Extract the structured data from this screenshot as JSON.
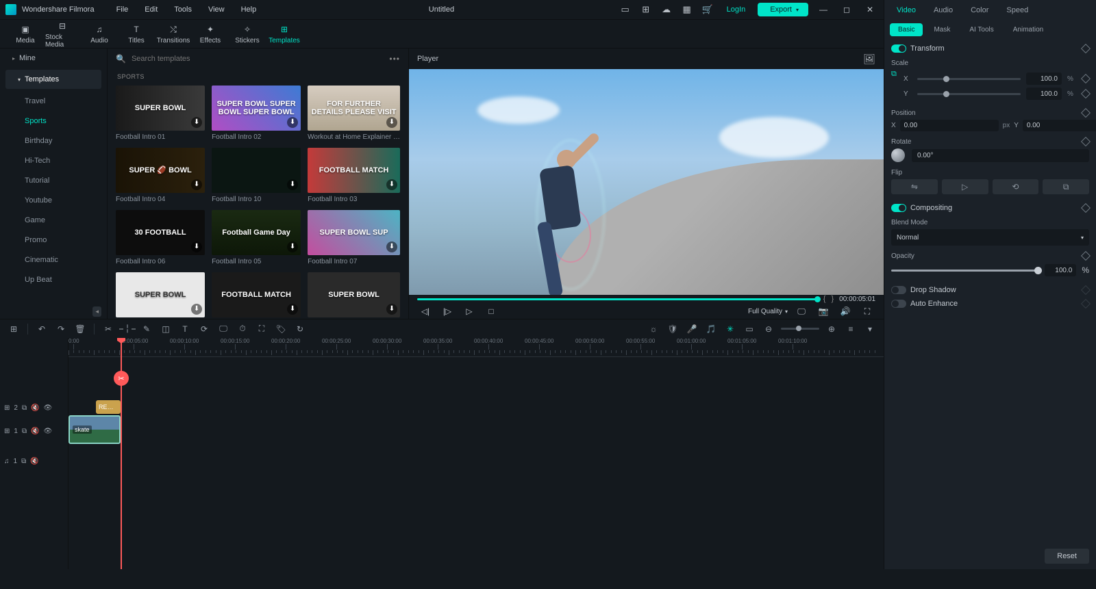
{
  "titlebar": {
    "appname": "Wondershare Filmora",
    "menus": [
      "File",
      "Edit",
      "Tools",
      "View",
      "Help"
    ],
    "title": "Untitled",
    "login": "LogIn",
    "export": "Export"
  },
  "ribbon": {
    "tabs": [
      {
        "label": "Media"
      },
      {
        "label": "Stock Media"
      },
      {
        "label": "Audio"
      },
      {
        "label": "Titles"
      },
      {
        "label": "Transitions"
      },
      {
        "label": "Effects"
      },
      {
        "label": "Stickers"
      },
      {
        "label": "Templates"
      }
    ]
  },
  "leftnav": {
    "mine": "Mine",
    "templates": "Templates",
    "subs": [
      "Travel",
      "Sports",
      "Birthday",
      "Hi-Tech",
      "Tutorial",
      "Youtube",
      "Game",
      "Promo",
      "Cinematic",
      "Up Beat"
    ],
    "active_sub": "Sports"
  },
  "search": {
    "placeholder": "Search templates"
  },
  "category_label": "SPORTS",
  "thumbs": [
    {
      "label": "Football Intro 01",
      "txt": "SUPER BOWL",
      "g": "g1"
    },
    {
      "label": "Football Intro 02",
      "txt": "SUPER BOWL SUPER BOWL SUPER BOWL",
      "g": "g2"
    },
    {
      "label": "Workout at Home Explainer …",
      "txt": "FOR FURTHER DETAILS PLEASE VISIT",
      "g": "g3"
    },
    {
      "label": "Football Intro 04",
      "txt": "SUPER 🏈 BOWL",
      "g": "g4"
    },
    {
      "label": "Football Intro 10",
      "txt": "",
      "g": "g5"
    },
    {
      "label": "Football Intro 03",
      "txt": "FOOTBALL MATCH",
      "g": "g6"
    },
    {
      "label": "Football Intro 06",
      "txt": "30 FOOTBALL",
      "g": "g7"
    },
    {
      "label": "Football Intro 05",
      "txt": "Football Game Day",
      "g": "g8"
    },
    {
      "label": "Football Intro 07",
      "txt": "SUPER BOWL SUP",
      "g": "g9"
    },
    {
      "label": "",
      "txt": "SUPER BOWL",
      "g": "g10"
    },
    {
      "label": "",
      "txt": "FOOTBALL MATCH",
      "g": "g11"
    },
    {
      "label": "",
      "txt": "SUPER BOWL",
      "g": "g12"
    }
  ],
  "preview": {
    "header": "Player",
    "time": "00:00:05:01",
    "quality": "Full Quality"
  },
  "rightpanel": {
    "tabs": [
      "Video",
      "Audio",
      "Color",
      "Speed"
    ],
    "subtabs": [
      "Basic",
      "Mask",
      "AI Tools",
      "Animation"
    ],
    "transform": "Transform",
    "scale": "Scale",
    "scale_x": "100.0",
    "scale_y": "100.0",
    "percent": "%",
    "position": "Position",
    "pos_x": "0.00",
    "pos_y": "0.00",
    "px": "px",
    "rotate": "Rotate",
    "rotate_val": "0.00°",
    "flip": "Flip",
    "compositing": "Compositing",
    "blend": "Blend Mode",
    "blend_val": "Normal",
    "opacity": "Opacity",
    "opacity_val": "100.0",
    "drop": "Drop Shadow",
    "auto": "Auto Enhance",
    "axis_x": "X",
    "axis_y": "Y",
    "reset": "Reset"
  },
  "timeline": {
    "ticks": [
      "0:00",
      "00:00:05:00",
      "00:00:10:00",
      "00:00:15:00",
      "00:00:20:00",
      "00:00:25:00",
      "00:00:30:00",
      "00:00:35:00",
      "00:00:40:00",
      "00:00:45:00",
      "00:00:50:00",
      "00:00:55:00",
      "00:01:00:00",
      "00:01:05:00",
      "00:01:10:00"
    ],
    "clip_title": "RE…",
    "clip_video": "skate"
  }
}
